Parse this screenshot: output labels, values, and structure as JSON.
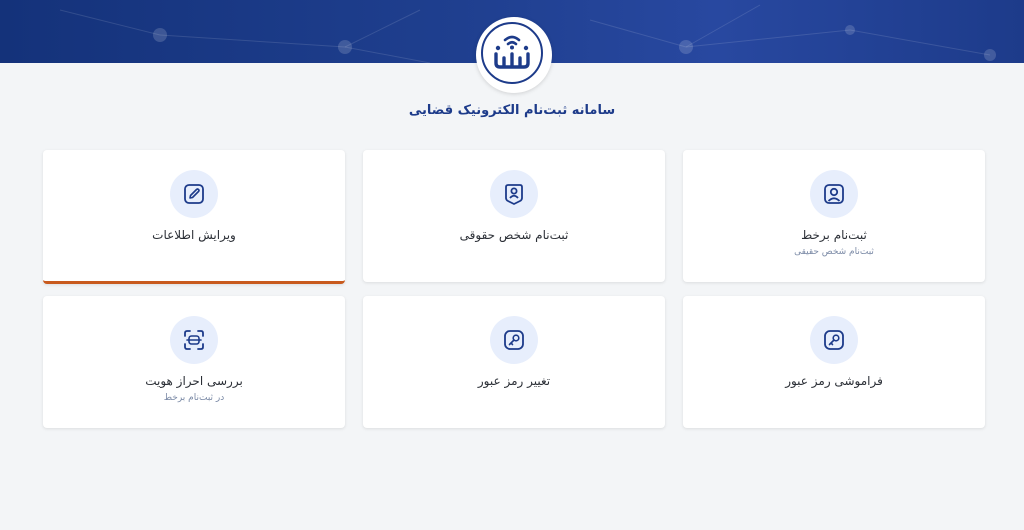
{
  "header": {
    "logo_text": "ثنا",
    "title": "سامانه ثبت‌نام الکترونیک قضایی"
  },
  "colors": {
    "brand": "#1d3b8a",
    "accent": "#c85a1e",
    "icon_bg": "#e7eefc"
  },
  "cards": [
    {
      "label": "ثبت‌نام برخط",
      "sub": "ثبت‌نام شخص حقیقی",
      "icon": "user-square-icon"
    },
    {
      "label": "ثبت‌نام شخص حقوقی",
      "sub": "",
      "icon": "user-badge-icon"
    },
    {
      "label": "ویرایش اطلاعات",
      "sub": "",
      "icon": "edit-pencil-icon",
      "active": true
    },
    {
      "label": "فراموشی رمز عبور",
      "sub": "",
      "icon": "key-icon"
    },
    {
      "label": "تغییر رمز عبور",
      "sub": "",
      "icon": "key-icon"
    },
    {
      "label": "بررسی احراز هویت",
      "sub": "در ثبت‌نام برخط",
      "icon": "scan-icon"
    }
  ]
}
